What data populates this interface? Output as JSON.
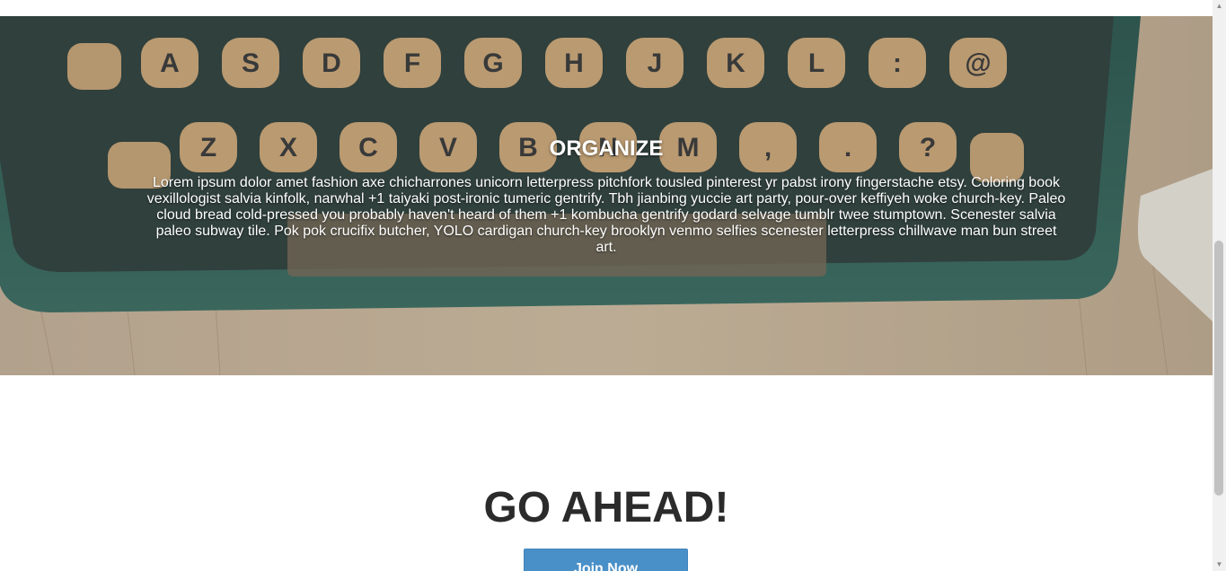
{
  "hero": {
    "title": "ORGANIZE",
    "text": "Lorem ipsum dolor amet fashion axe chicharrones unicorn letterpress pitchfork tousled pinterest yr pabst irony fingerstache etsy. Coloring book vexillologist salvia kinfolk, narwhal +1 taiyaki post-ironic tumeric gentrify. Tbh jianbing yuccie art party, pour-over keffiyeh woke church-key. Paleo cloud bread cold-pressed you probably haven't heard of them +1 kombucha gentrify godard selvage tumblr twee stumptown. Scenester salvia paleo subway tile. Pok pok crucifix butcher, YOLO cardigan church-key brooklyn venmo selfies scenester letterpress chillwave man bun street art.",
    "background_image": "typewriter-keyboard-photo",
    "keys_row1": [
      "A",
      "S",
      "D",
      "F",
      "G",
      "H",
      "J",
      "K",
      "L",
      ":",
      "@"
    ],
    "keys_row2": [
      "Z",
      "X",
      "C",
      "V",
      "B",
      "N",
      "M",
      ",",
      ".",
      "?"
    ]
  },
  "cta": {
    "heading": "GO AHEAD!",
    "button_label": "Join Now",
    "button_color": "#4a90c8"
  },
  "scrollbar": {
    "icon_up": "scroll-up-arrow-icon",
    "icon_down": "scroll-down-arrow-icon"
  }
}
